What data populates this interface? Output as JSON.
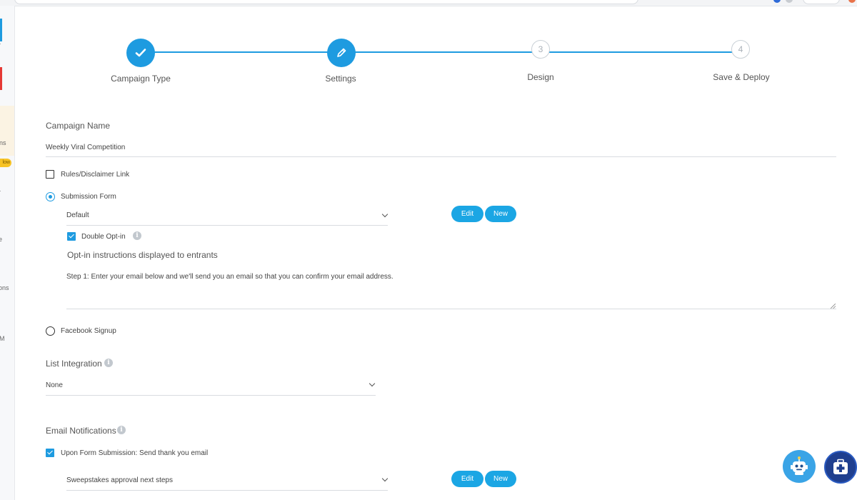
{
  "sidebar": {
    "fragments": [
      "r",
      "ns",
      "low",
      "r",
      "e",
      "ons",
      "M"
    ]
  },
  "stepper": {
    "steps": [
      {
        "label": "Campaign Type",
        "number": "",
        "state": "completed",
        "icon": "check-icon"
      },
      {
        "label": "Settings",
        "number": "",
        "state": "active",
        "icon": "pencil-icon"
      },
      {
        "label": "Design",
        "number": "3",
        "state": "pending"
      },
      {
        "label": "Save & Deploy",
        "number": "4",
        "state": "pending"
      }
    ]
  },
  "form": {
    "campaign_name_label": "Campaign Name",
    "campaign_name_value": "Weekly Viral Competition",
    "rules_label": "Rules/Disclaimer Link",
    "rules_checked": false,
    "submission_form_label": "Submission Form",
    "submission_form_selected": true,
    "submission_form_dropdown": "Default",
    "edit_label": "Edit",
    "new_label": "New",
    "double_optin_label": "Double Opt-in",
    "double_optin_checked": true,
    "optin_instructions_title": "Opt-in instructions displayed to entrants",
    "optin_instructions_text": "Step 1: Enter your email below and we'll send you an email so that you can confirm your email address.",
    "facebook_signup_label": "Facebook Signup",
    "facebook_signup_selected": false,
    "list_integration_label": "List Integration",
    "list_integration_value": "None",
    "email_notifications_label": "Email Notifications",
    "upon_submission_label": "Upon Form Submission: Send thank you email",
    "upon_submission_checked": true,
    "email_template_value": "Sweepstakes approval next steps"
  },
  "colors": {
    "accent": "#1e9be0",
    "button": "#1ba6e4",
    "fab_bot": "#3aa4e6",
    "fab_help": "#1f3f8f"
  },
  "icons": [
    "check-icon",
    "pencil-icon",
    "info-icon",
    "chevron-down-icon",
    "robot-icon",
    "medical-kit-icon"
  ]
}
